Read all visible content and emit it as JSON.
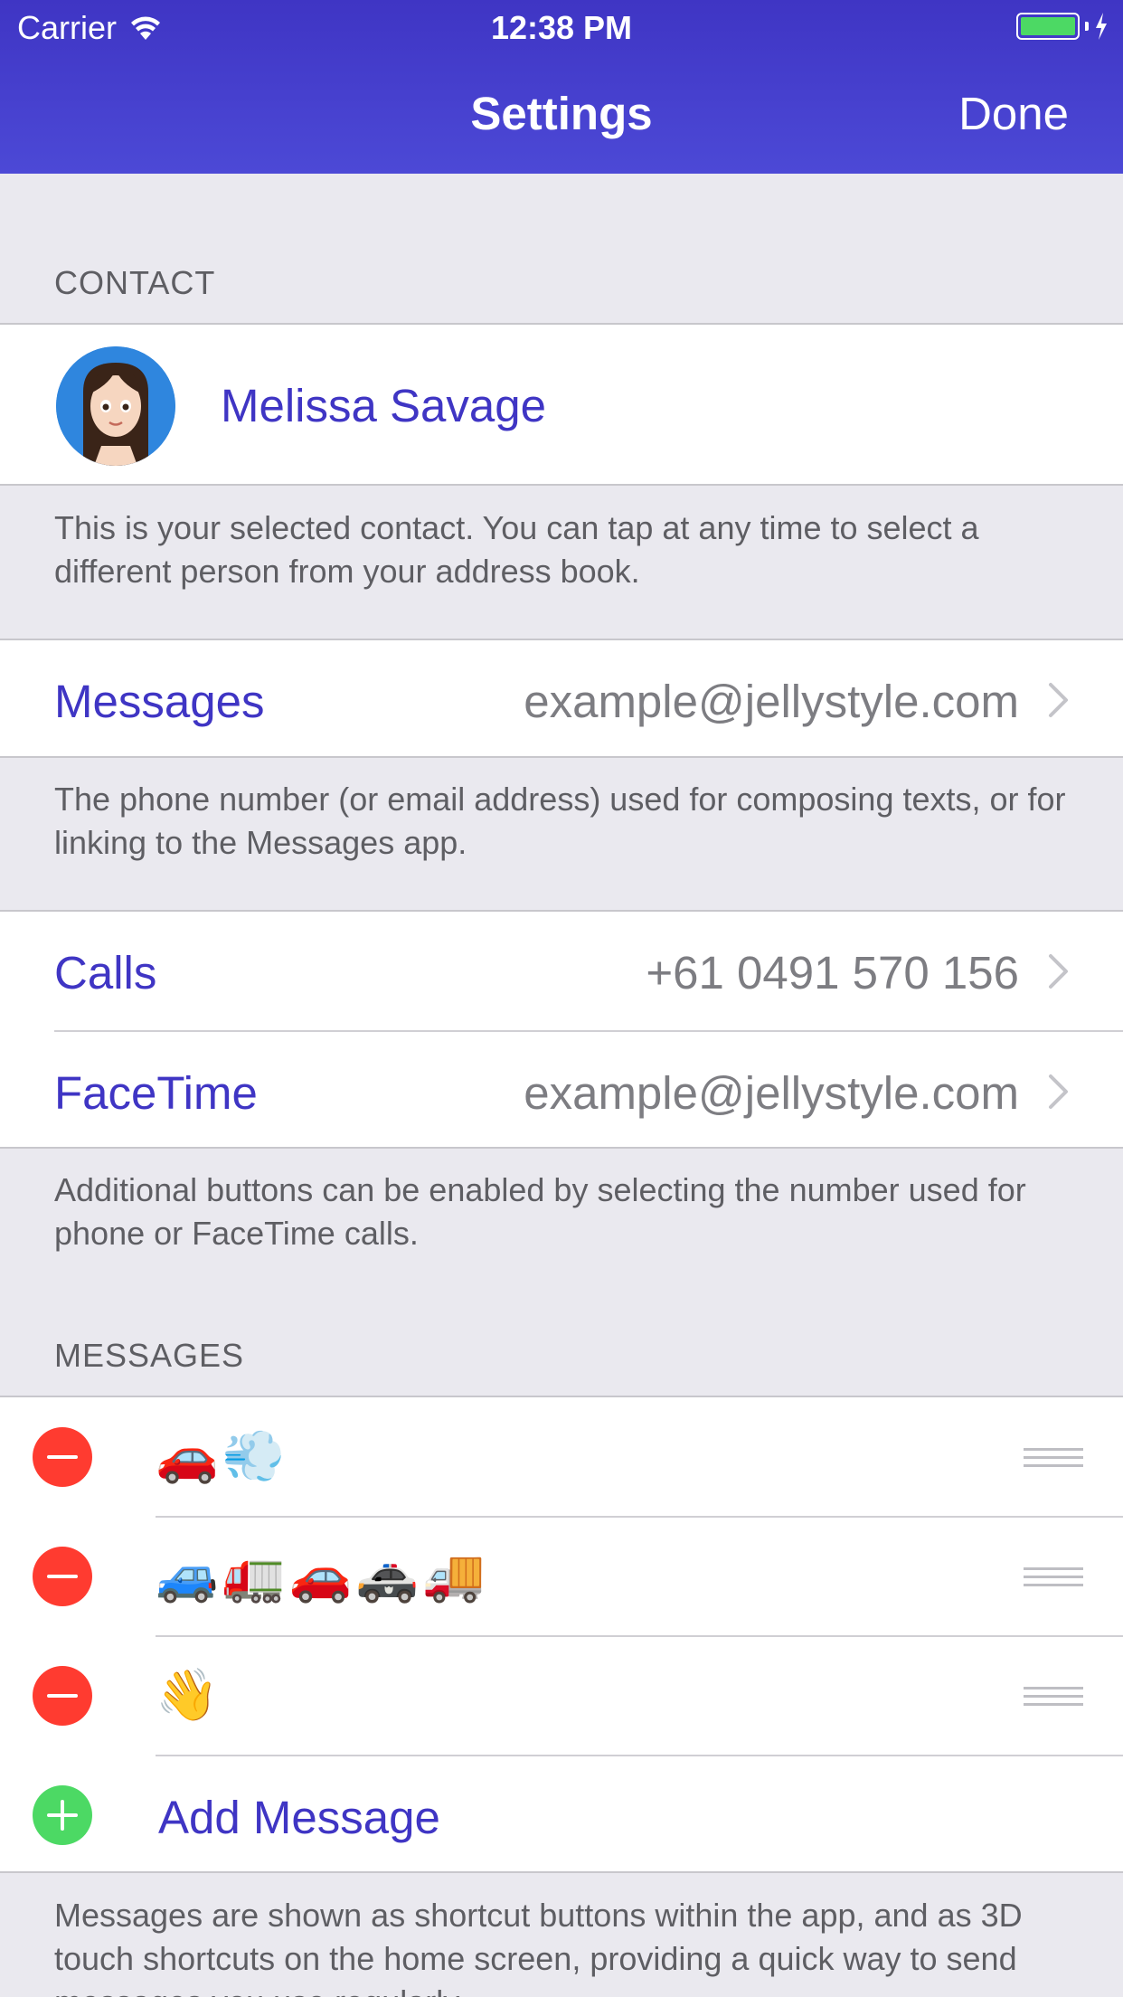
{
  "status_bar": {
    "carrier": "Carrier",
    "time": "12:38 PM",
    "wifi_icon": "wifi-icon",
    "battery_icon": "battery-charging-icon",
    "battery_color": "#4CD964"
  },
  "nav": {
    "title": "Settings",
    "done_label": "Done",
    "accent_color": "#3F35C4"
  },
  "contact_section": {
    "header": "CONTACT",
    "name": "Melissa Savage",
    "avatar_icon": "avatar-cartoon-woman",
    "footer": "This is your selected contact. You can tap at any time to select a different person from your address book."
  },
  "messages_row": {
    "label": "Messages",
    "value": "example@jellystyle.com",
    "footer": "The phone number (or email address) used for composing texts, or for linking to the Messages app."
  },
  "calls_section": {
    "calls_label": "Calls",
    "calls_value": "+61 0491 570 156",
    "facetime_label": "FaceTime",
    "facetime_value": "example@jellystyle.com",
    "footer": "Additional buttons can be enabled by selecting the number used for phone or FaceTime calls."
  },
  "messages_section": {
    "header": "MESSAGES",
    "items": [
      {
        "text": "🚗💨"
      },
      {
        "text": "🚙🚛🚗🚓🚚"
      },
      {
        "text": "👋"
      }
    ],
    "add_label": "Add Message",
    "footer": "Messages are shown as shortcut buttons within the app, and as 3D touch shortcuts on the home screen, providing a quick way to send messages you use regularly."
  },
  "colors": {
    "destructive": "#FF3B30",
    "add": "#4CD964",
    "background": "#EAE9EF"
  }
}
